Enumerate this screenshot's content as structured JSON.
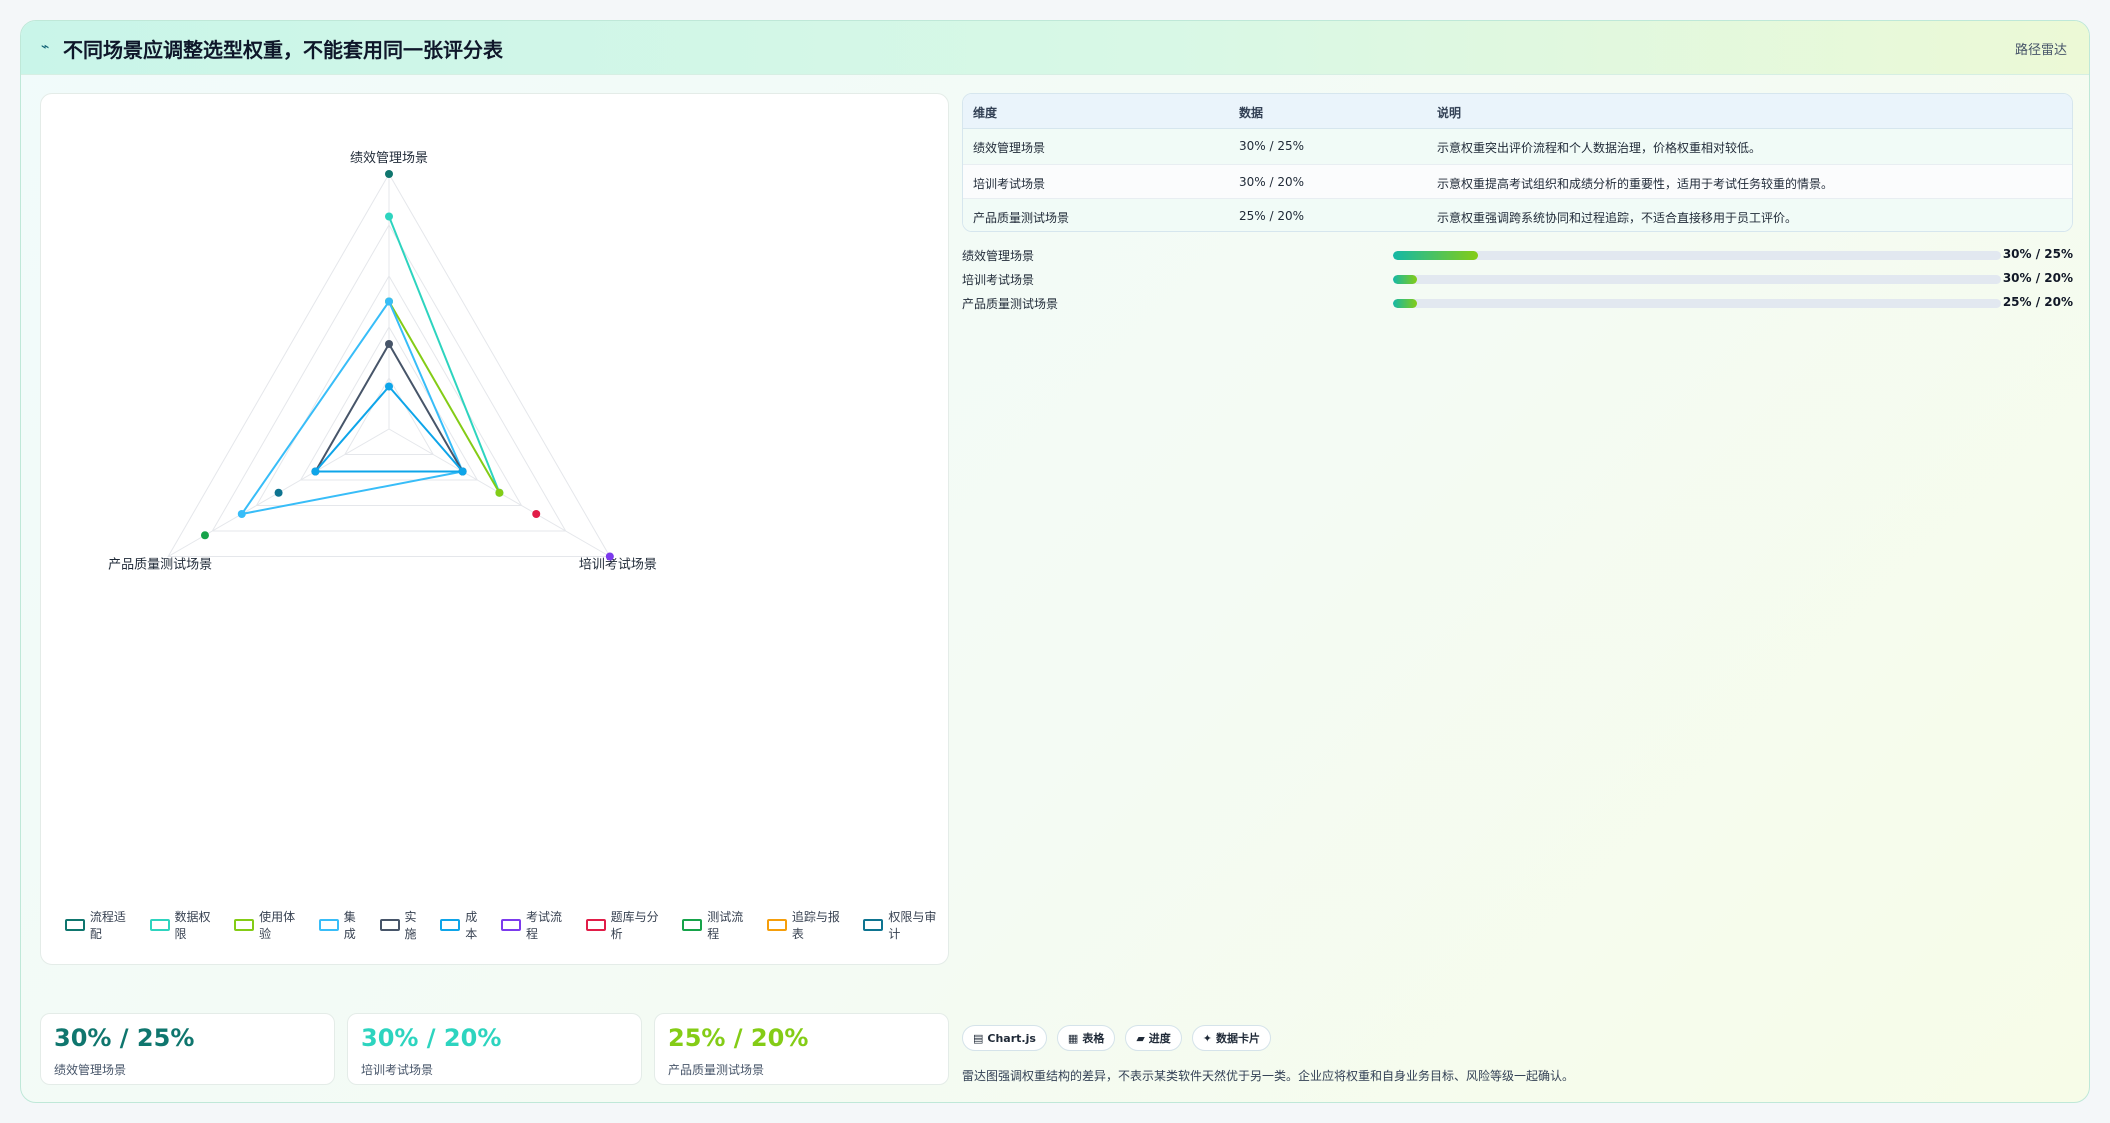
{
  "header": {
    "title": "不同场景应调整选型权重，不能套用同一张评分表",
    "right_label": "路径雷达",
    "logo_glyph": "⌁"
  },
  "chart_data": {
    "type": "radar",
    "axes": [
      "绩效管理场景",
      "培训考试场景",
      "产品质量测试场景"
    ],
    "rmax": 30,
    "series": [
      {
        "name": "流程适配",
        "color": "#0f766e",
        "values": [
          30,
          null,
          null
        ]
      },
      {
        "name": "数据权限",
        "color": "#2dd4bf",
        "values": [
          25,
          15,
          null
        ]
      },
      {
        "name": "使用体验",
        "color": "#84cc16",
        "values": [
          15,
          15,
          null
        ]
      },
      {
        "name": "集成",
        "color": "#38bdf8",
        "values": [
          15,
          10,
          20
        ]
      },
      {
        "name": "实施",
        "color": "#475569",
        "values": [
          10,
          10,
          10
        ]
      },
      {
        "name": "成本",
        "color": "#0ea5e9",
        "values": [
          5,
          10,
          10
        ]
      },
      {
        "name": "考试流程",
        "color": "#7c3aed",
        "values": [
          null,
          30,
          null
        ]
      },
      {
        "name": "题库与分析",
        "color": "#e11d48",
        "values": [
          null,
          20,
          null
        ]
      },
      {
        "name": "测试流程",
        "color": "#16a34a",
        "values": [
          null,
          null,
          25
        ]
      },
      {
        "name": "追踪与报表",
        "color": "#f59e0b",
        "values": [
          null,
          null,
          null
        ]
      },
      {
        "name": "权限与审计",
        "color": "#0e7490",
        "values": [
          null,
          null,
          15
        ]
      }
    ]
  },
  "table": {
    "headers": [
      "维度",
      "数据",
      "说明"
    ],
    "rows": [
      [
        "绩效管理场景",
        "30% / 25%",
        "示意权重突出评价流程和个人数据治理，价格权重相对较低。"
      ],
      [
        "培训考试场景",
        "30% / 20%",
        "示意权重提高考试组织和成绩分析的重要性，适用于考试任务较重的情景。"
      ],
      [
        "产品质量测试场景",
        "25% / 20%",
        "示意权重强调跨系统协同和过程追踪，不适合直接移用于员工评价。"
      ]
    ]
  },
  "progress": [
    {
      "label": "绩效管理场景",
      "value": "30% / 25%",
      "fill": 0.14
    },
    {
      "label": "培训考试场景",
      "value": "30% / 20%",
      "fill": 0.04
    },
    {
      "label": "产品质量测试场景",
      "value": "25% / 20%",
      "fill": 0.04
    }
  ],
  "cards": [
    {
      "value": "30% / 25%",
      "label": "绩效管理场景",
      "color": "#0f766e"
    },
    {
      "value": "30% / 20%",
      "label": "培训考试场景",
      "color": "#2dd4bf"
    },
    {
      "value": "25% / 20%",
      "label": "产品质量测试场景",
      "color": "#84cc16"
    }
  ],
  "tags": [
    "Chart.js",
    "表格",
    "进度",
    "数据卡片"
  ],
  "tag_icons": [
    "▤",
    "▦",
    "▰",
    "✦"
  ],
  "footnote": "雷达图强调权重结构的差异，不表示某类软件天然优于另一类。企业应将权重和自身业务目标、风险等级一起确认。"
}
